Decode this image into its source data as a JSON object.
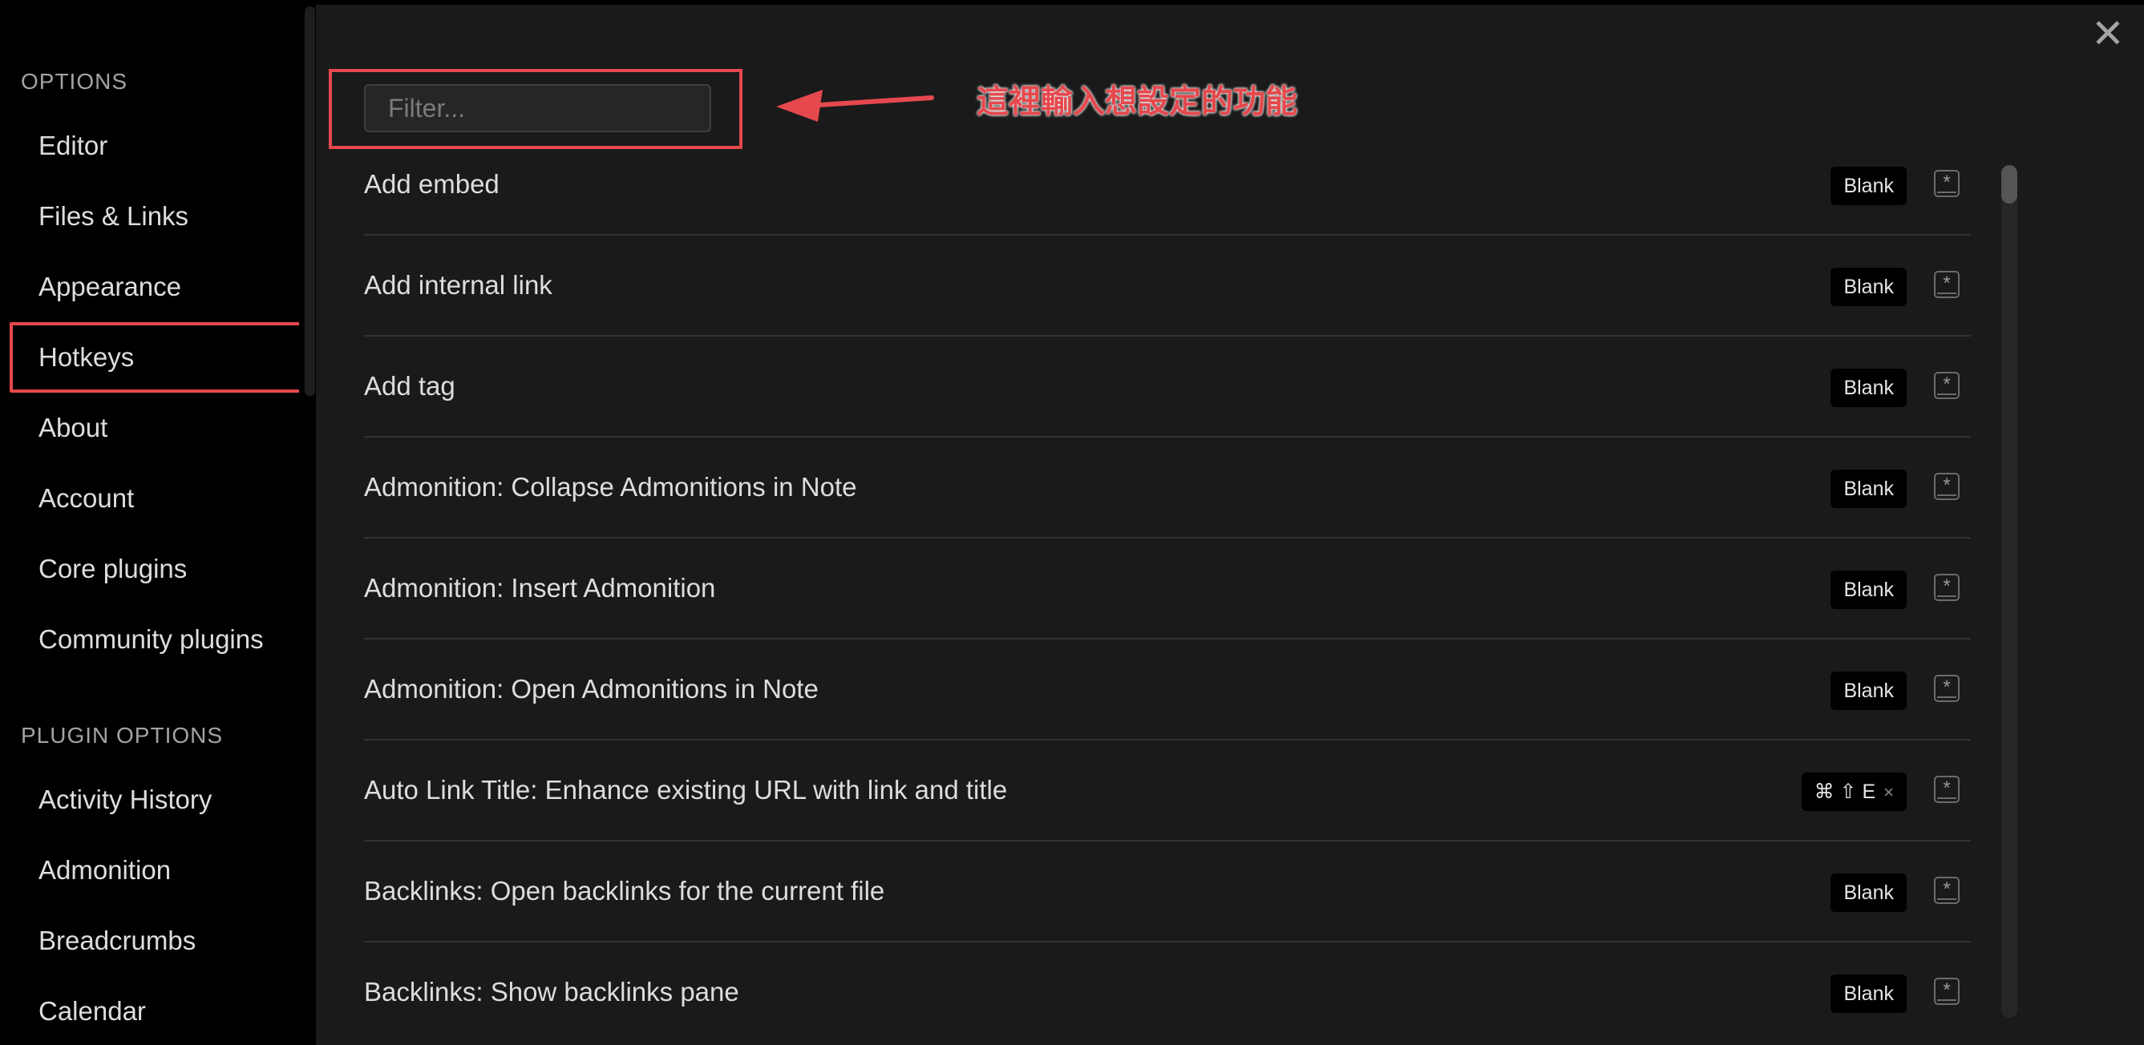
{
  "sidebar": {
    "options_title": "OPTIONS",
    "options_items": [
      {
        "label": "Editor"
      },
      {
        "label": "Files & Links"
      },
      {
        "label": "Appearance"
      },
      {
        "label": "Hotkeys"
      },
      {
        "label": "About"
      },
      {
        "label": "Account"
      },
      {
        "label": "Core plugins"
      },
      {
        "label": "Community plugins"
      }
    ],
    "plugin_options_title": "PLUGIN OPTIONS",
    "plugin_items": [
      {
        "label": "Activity History"
      },
      {
        "label": "Admonition"
      },
      {
        "label": "Breadcrumbs"
      },
      {
        "label": "Calendar"
      }
    ]
  },
  "filter": {
    "placeholder": "Filter..."
  },
  "annotation": {
    "text": "這裡輸入想設定的功能",
    "color": "#e5484d"
  },
  "hotkeys": [
    {
      "name": "Add embed",
      "hotkey": "Blank"
    },
    {
      "name": "Add internal link",
      "hotkey": "Blank"
    },
    {
      "name": "Add tag",
      "hotkey": "Blank"
    },
    {
      "name": "Admonition: Collapse Admonitions in Note",
      "hotkey": "Blank"
    },
    {
      "name": "Admonition: Insert Admonition",
      "hotkey": "Blank"
    },
    {
      "name": "Admonition: Open Admonitions in Note",
      "hotkey": "Blank"
    },
    {
      "name": "Auto Link Title: Enhance existing URL with link and title",
      "hotkey": "⌘ ⇧ E",
      "removable": true,
      "remove_glyph": "×"
    },
    {
      "name": "Backlinks: Open backlinks for the current file",
      "hotkey": "Blank"
    },
    {
      "name": "Backlinks: Show backlinks pane",
      "hotkey": "Blank"
    }
  ],
  "close_glyph": "✕",
  "add_glyph": "*"
}
